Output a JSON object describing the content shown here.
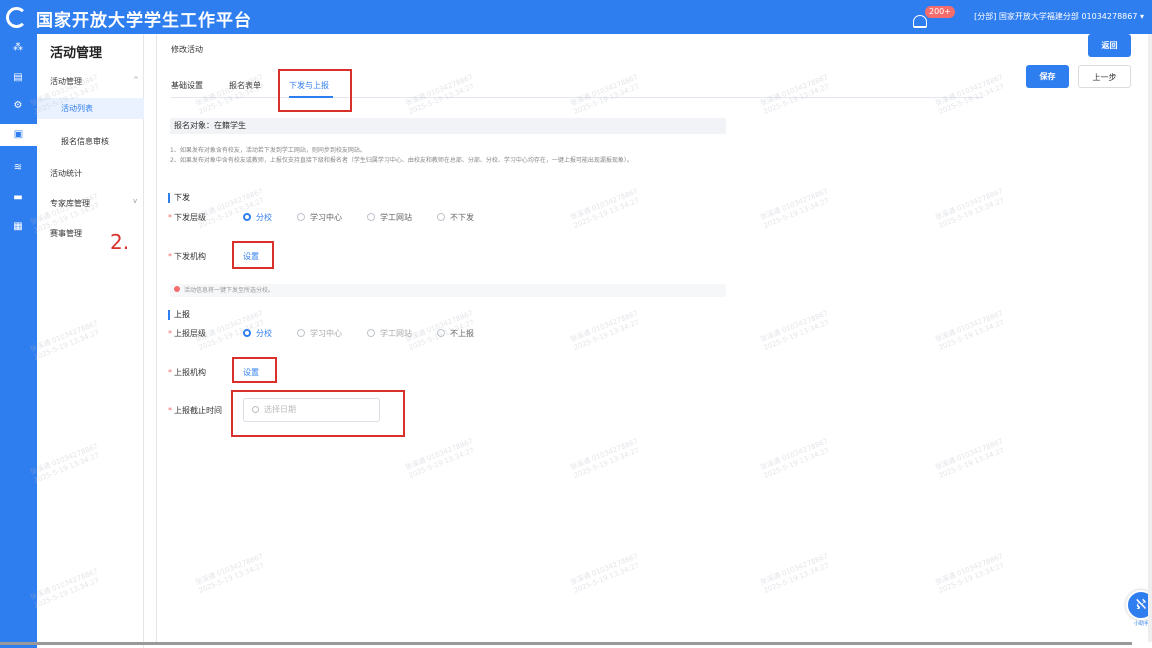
{
  "app": {
    "title": "国家开放大学学生工作平台",
    "notification_count": "200+",
    "user": "[分部] 国家开放大学福建分部 01034278867 ▾"
  },
  "sidebar": {
    "title": "活动管理",
    "items": [
      {
        "label": "活动管理",
        "caret": "^"
      },
      {
        "label": "活动列表"
      },
      {
        "label": "报名信息审核"
      },
      {
        "label": "活动统计"
      },
      {
        "label": "专家库管理",
        "caret": "v"
      },
      {
        "label": "赛事管理"
      }
    ]
  },
  "page": {
    "breadcrumb": "修改活动",
    "back_label": "返回",
    "save_label": "保存",
    "prev_label": "上一步",
    "tabs": [
      "基础设置",
      "报名表单",
      "下发与上报"
    ]
  },
  "form": {
    "target": "报名对象：在籍学生",
    "notes": [
      "1、如果发布对象含有校友，活动若下发到学工网站，则同步到校友网站。",
      "2、如果发布对象中含有校友或教师，上报仅支持直接下级和报名者（学生归属学习中心、由校友和教师在总部、分部、分校、学习中心均存在，一键上报可能出现漏报现象）。"
    ],
    "issue": {
      "title": "下发",
      "level_label": "下发层级",
      "options": [
        "分校",
        "学习中心",
        "学工网站",
        "不下发"
      ],
      "org_label": "下发机构",
      "org_action": "设置",
      "tip": "活动信息将一键下发至所选分校。"
    },
    "report": {
      "title": "上报",
      "level_label": "上报层级",
      "options": [
        "分校",
        "学习中心",
        "学工网站",
        "不上报"
      ],
      "org_label": "上报机构",
      "org_action": "设置",
      "deadline_label": "上报截止时间",
      "deadline_placeholder": "选择日期"
    }
  },
  "annotation": "2.",
  "watermark": {
    "line1": "张溪通 01034278867",
    "line2": "2025-5-19 13:34:27"
  },
  "helper": {
    "label": "小助手"
  },
  "colors": {
    "primary": "#2f7ef0",
    "highlight": "#d9302c",
    "danger": "#f56c6c"
  },
  "icons": {
    "logo": "logo-icon",
    "bell": "bell-icon"
  }
}
